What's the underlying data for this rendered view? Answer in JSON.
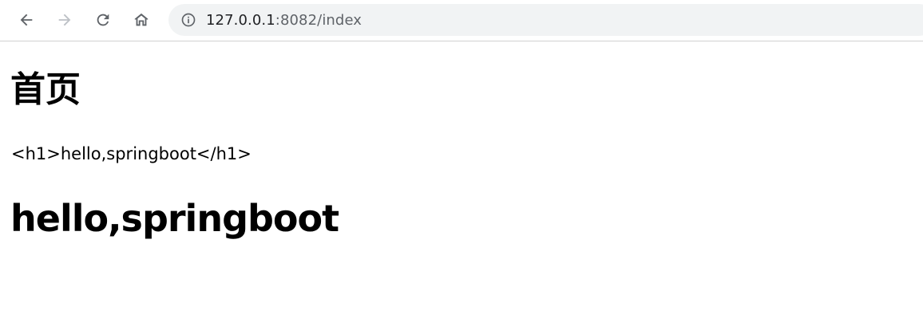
{
  "browser": {
    "url_host": "127.0.0.1",
    "url_rest": ":8082/index",
    "icons": {
      "back": "back-arrow-icon",
      "forward": "forward-arrow-icon",
      "reload": "reload-icon",
      "home": "home-icon",
      "info": "info-icon"
    },
    "colors": {
      "omnibox_bg": "#f1f3f4",
      "icon_active": "#5f6368",
      "icon_disabled": "#bdc1c6"
    }
  },
  "page": {
    "heading": "首页",
    "paragraph": "<h1>hello,springboot</h1>",
    "rendered_heading": "hello,springboot"
  }
}
